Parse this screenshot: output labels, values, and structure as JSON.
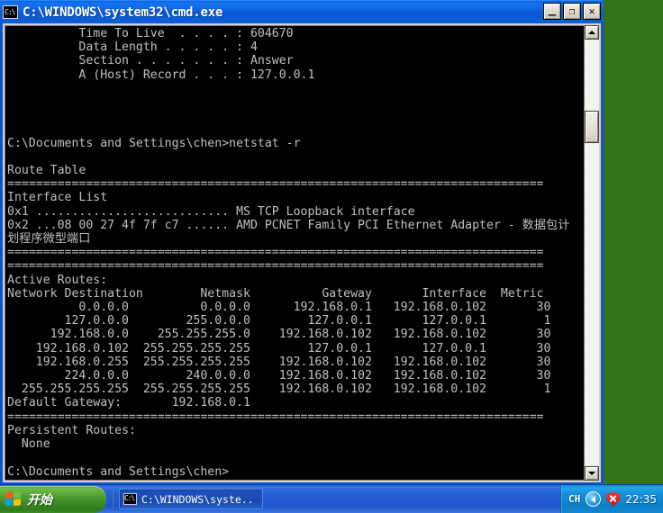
{
  "window": {
    "title": "C:\\WINDOWS\\system32\\cmd.exe",
    "icon": "cmd-console-icon",
    "buttons": {
      "minimize": "_",
      "maximize": "❐",
      "close": "✕"
    }
  },
  "console": {
    "text": "          Time To Live  . . . . : 604670\n          Data Length . . . . . : 4\n          Section . . . . . . . : Answer\n          A (Host) Record . . . : 127.0.0.1\n\n\n\n\nC:\\Documents and Settings\\chen>netstat -r\n\nRoute Table\n===========================================================================\nInterface List\n0x1 ........................... MS TCP Loopback interface\n0x2 ...08 00 27 4f 7f c7 ...... AMD PCNET Family PCI Ethernet Adapter - 数据包计\n划程序微型端口\n===========================================================================\n===========================================================================\nActive Routes:\nNetwork Destination        Netmask          Gateway       Interface  Metric\n          0.0.0.0          0.0.0.0      192.168.0.1   192.168.0.102       30\n        127.0.0.0        255.0.0.0        127.0.0.1       127.0.0.1        1\n      192.168.0.0    255.255.255.0    192.168.0.102   192.168.0.102       30\n    192.168.0.102  255.255.255.255        127.0.0.1       127.0.0.1       30\n    192.168.0.255  255.255.255.255    192.168.0.102   192.168.0.102       30\n        224.0.0.0        240.0.0.0    192.168.0.102   192.168.0.102       30\n  255.255.255.255  255.255.255.255    192.168.0.102   192.168.0.102        1\nDefault Gateway:       192.168.0.1\n===========================================================================\nPersistent Routes:\n  None\n\nC:\\Documents and Settings\\chen>",
    "lines": [
      "          Time To Live  . . . . : 604670",
      "          Data Length . . . . . : 4",
      "          Section . . . . . . . : Answer",
      "          A (Host) Record . . . : 127.0.0.1",
      "",
      "",
      "",
      "",
      "C:\\Documents and Settings\\chen>netstat -r",
      "",
      "Route Table",
      "===========================================================================",
      "Interface List",
      "0x1 ........................... MS TCP Loopback interface",
      "0x2 ...08 00 27 4f 7f c7 ...... AMD PCNET Family PCI Ethernet Adapter - 数据包计",
      "划程序微型端口",
      "===========================================================================",
      "===========================================================================",
      "Active Routes:",
      "Network Destination        Netmask          Gateway       Interface  Metric",
      "          0.0.0.0          0.0.0.0      192.168.0.1   192.168.0.102       30",
      "        127.0.0.0        255.0.0.0        127.0.0.1       127.0.0.1        1",
      "      192.168.0.0    255.255.255.0    192.168.0.102   192.168.0.102       30",
      "    192.168.0.102  255.255.255.255        127.0.0.1       127.0.0.1       30",
      "    192.168.0.255  255.255.255.255    192.168.0.102   192.168.0.102       30",
      "        224.0.0.0        240.0.0.0    192.168.0.102   192.168.0.102       30",
      "  255.255.255.255  255.255.255.255    192.168.0.102   192.168.0.102        1",
      "Default Gateway:       192.168.0.1",
      "===========================================================================",
      "Persistent Routes:",
      "  None",
      "",
      "C:\\Documents and Settings\\chen>"
    ],
    "dns_record": {
      "time_to_live": "604670",
      "data_length": "4",
      "section": "Answer",
      "a_host_record": "127.0.0.1"
    },
    "command": "netstat -r",
    "prompt": "C:\\Documents and Settings\\chen>",
    "route_table_title": "Route Table",
    "interface_list_title": "Interface List",
    "interfaces": [
      {
        "id": "0x1",
        "mac": "",
        "description": "MS TCP Loopback interface"
      },
      {
        "id": "0x2",
        "mac": "...08 00 27 4f 7f c7",
        "description": "AMD PCNET Family PCI Ethernet Adapter - 数据包计划程序微型端口"
      }
    ],
    "active_routes_title": "Active Routes:",
    "route_columns": [
      "Network Destination",
      "Netmask",
      "Gateway",
      "Interface",
      "Metric"
    ],
    "routes": [
      [
        "0.0.0.0",
        "0.0.0.0",
        "192.168.0.1",
        "192.168.0.102",
        "30"
      ],
      [
        "127.0.0.0",
        "255.0.0.0",
        "127.0.0.1",
        "127.0.0.1",
        "1"
      ],
      [
        "192.168.0.0",
        "255.255.255.0",
        "192.168.0.102",
        "192.168.0.102",
        "30"
      ],
      [
        "192.168.0.102",
        "255.255.255.255",
        "127.0.0.1",
        "127.0.0.1",
        "30"
      ],
      [
        "192.168.0.255",
        "255.255.255.255",
        "192.168.0.102",
        "192.168.0.102",
        "30"
      ],
      [
        "224.0.0.0",
        "240.0.0.0",
        "192.168.0.102",
        "192.168.0.102",
        "30"
      ],
      [
        "255.255.255.255",
        "255.255.255.255",
        "192.168.0.102",
        "192.168.0.102",
        "1"
      ]
    ],
    "default_gateway_label": "Default Gateway:",
    "default_gateway": "192.168.0.1",
    "persistent_routes_title": "Persistent Routes:",
    "persistent_routes": "None",
    "colors": {
      "background": "#000000",
      "foreground": "#c0c0c0"
    }
  },
  "taskbar": {
    "start_label": "开始",
    "task_buttons": [
      {
        "label": "C:\\WINDOWS\\syste...",
        "icon": "cmd-console-icon"
      }
    ],
    "tray": {
      "language": "CH",
      "expand_icon": "show-hidden-icons-arrow",
      "security_icon": "security-alert-shield",
      "clock": "22:35"
    },
    "colors": {
      "taskbar_blue": "#245fd2",
      "start_green": "#3d8c25",
      "tray_blue": "#0d7ec8"
    }
  },
  "desktop": {
    "wallpaper_name": "Bliss",
    "colors": {
      "sky": "#4e8ce0",
      "grass": "#4e8f28"
    }
  }
}
